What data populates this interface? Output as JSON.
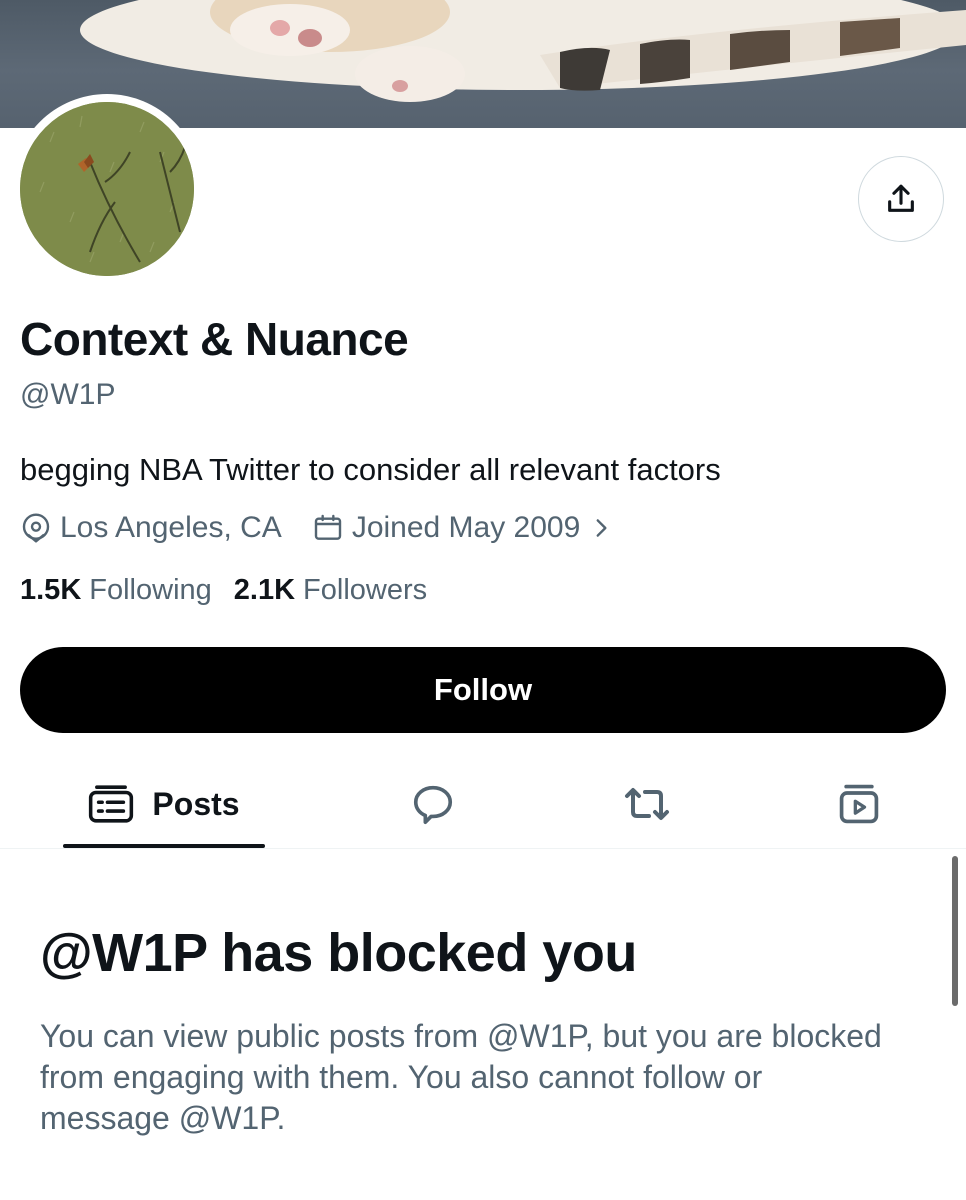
{
  "profile": {
    "display_name": "Context & Nuance",
    "handle": "@W1P",
    "bio": "begging NBA Twitter to consider all relevant factors",
    "location": "Los Angeles, CA",
    "joined": "Joined May 2009",
    "following_count": "1.5K",
    "following_label": "Following",
    "followers_count": "2.1K",
    "followers_label": "Followers"
  },
  "actions": {
    "follow_label": "Follow",
    "share_icon": "share-icon"
  },
  "tabs": [
    {
      "label": "Posts",
      "icon": "posts-icon",
      "active": true
    },
    {
      "label": "",
      "icon": "replies-icon",
      "active": false
    },
    {
      "label": "",
      "icon": "reposts-icon",
      "active": false
    },
    {
      "label": "",
      "icon": "media-icon",
      "active": false
    }
  ],
  "blocked_notice": {
    "title": "@W1P has blocked you",
    "body": "You can view public posts from @W1P, but you are blocked from engaging with them. You also cannot follow or message @W1P."
  },
  "colors": {
    "text_primary": "#0f1419",
    "text_secondary": "#536471",
    "button_bg": "#000000",
    "border": "#cfd9de"
  }
}
